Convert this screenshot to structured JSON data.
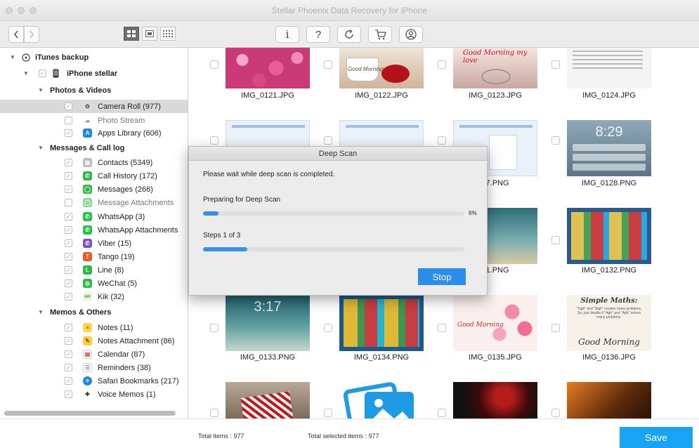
{
  "window": {
    "title": "Stellar Phoenix Data Recovery for iPhone"
  },
  "toolbar": {
    "nav_back_icon": "chevron-left-icon",
    "nav_forward_icon": "chevron-right-icon",
    "view_modes": [
      "large-grid-icon",
      "medium-grid-icon",
      "small-grid-icon"
    ],
    "actions": [
      "info-icon",
      "help-icon",
      "refresh-icon",
      "cart-icon",
      "account-icon"
    ],
    "info_label": "i",
    "help_label": "?"
  },
  "sidebar": {
    "items": [
      {
        "label": "iTunes backup",
        "checked": null,
        "icon": "itunes-icon"
      },
      {
        "label": "iPhone stellar",
        "checked": true,
        "icon": "iphone-icon"
      },
      {
        "label": "Photos & Videos"
      },
      {
        "label": "Camera Roll (977)",
        "checked": true,
        "icon": "camera-roll-icon"
      },
      {
        "label": "Photo Stream",
        "checked": false,
        "icon": "photo-stream-icon"
      },
      {
        "label": "Apps Library (606)",
        "checked": true,
        "icon": "apps-library-icon"
      },
      {
        "label": "Messages & Call log"
      },
      {
        "label": "Contacts (5349)",
        "checked": true,
        "icon": "contacts-icon"
      },
      {
        "label": "Call History (172)",
        "checked": true,
        "icon": "call-history-icon"
      },
      {
        "label": "Messages (266)",
        "checked": true,
        "icon": "messages-icon"
      },
      {
        "label": "Message Attachments",
        "checked": false,
        "icon": "message-attachments-icon"
      },
      {
        "label": "WhatsApp (3)",
        "checked": true,
        "icon": "whatsapp-icon"
      },
      {
        "label": "WhatsApp Attachments",
        "checked": true,
        "icon": "whatsapp-attachments-icon"
      },
      {
        "label": "Viber (15)",
        "checked": true,
        "icon": "viber-icon"
      },
      {
        "label": "Tango (19)",
        "checked": true,
        "icon": "tango-icon"
      },
      {
        "label": "Line (8)",
        "checked": true,
        "icon": "line-icon"
      },
      {
        "label": "WeChat (5)",
        "checked": true,
        "icon": "wechat-icon"
      },
      {
        "label": "Kik (32)",
        "checked": true,
        "icon": "kik-icon"
      },
      {
        "label": "Memos & Others"
      },
      {
        "label": "Notes (11)",
        "checked": true,
        "icon": "notes-icon"
      },
      {
        "label": "Notes Attachment (86)",
        "checked": true,
        "icon": "notes-attachment-icon"
      },
      {
        "label": "Calendar (87)",
        "checked": true,
        "icon": "calendar-icon"
      },
      {
        "label": "Reminders (38)",
        "checked": true,
        "icon": "reminders-icon"
      },
      {
        "label": "Safari Bookmarks (217)",
        "checked": true,
        "icon": "safari-bookmarks-icon"
      },
      {
        "label": "Voice Memos (1)",
        "checked": true,
        "icon": "voice-memos-icon"
      }
    ]
  },
  "grid": {
    "files": [
      "IMG_0121.JPG",
      "IMG_0122.JPG",
      "IMG_0123.JPG",
      "IMG_0124.JPG",
      "",
      "",
      "27.PNG",
      "IMG_0128.PNG",
      "",
      "",
      "31.PNG",
      "IMG_0132.PNG",
      "IMG_0133.PNG",
      "IMG_0134.PNG",
      "IMG_0135.JPG",
      "IMG_0136.JPG"
    ],
    "thumb_text": {
      "t122": "Good Morning",
      "t123": "Good Morning my love",
      "t128_time": "8:29",
      "t133_time": "3:17",
      "t135": "Good Morning",
      "t136_title": "Simple Maths:",
      "t136_body": "\"Sigh\" and \"Sigh\" creates many problems. So, just double it \"Agh\" and \"Agh\" solves many problems.",
      "t136_footer": "Good Morning"
    }
  },
  "dialog": {
    "title": "Deep Scan",
    "message": "Please wait while deep scan is completed.",
    "progress_label": "Preparing for Deep Scan",
    "progress_percent_text": "6%",
    "progress_value": 0.06,
    "steps_label": "Steps 1 of 3",
    "steps_value": 0.17,
    "stop_label": "Stop"
  },
  "status": {
    "total_items": "Total items : 977",
    "total_selected": "Total selected items : 977",
    "save_label": "Save"
  },
  "colors": {
    "accent": "#1aa3f3",
    "progress": "#3a8ee6"
  }
}
